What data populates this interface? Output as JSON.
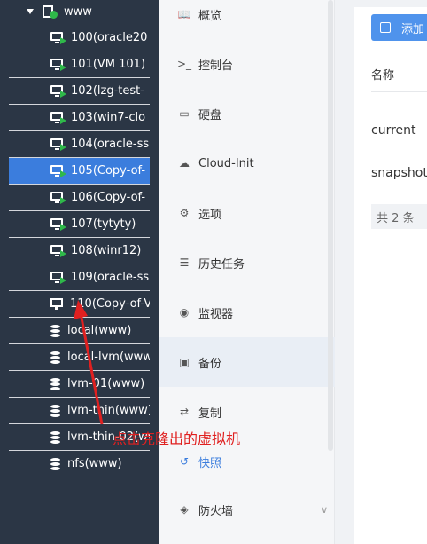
{
  "tree": {
    "host": {
      "label": "www",
      "icon": "server-check-icon"
    },
    "vms": [
      {
        "label": "100(oracle20",
        "icon": "vm-running-icon"
      },
      {
        "label": "101(VM 101)",
        "icon": "vm-running-icon"
      },
      {
        "label": "102(lzg-test-",
        "icon": "vm-running-icon"
      },
      {
        "label": "103(win7-clo",
        "icon": "vm-running-icon"
      },
      {
        "label": "104(oracle-ss",
        "icon": "vm-running-icon"
      },
      {
        "label": "105(Copy-of-",
        "icon": "vm-running-icon",
        "selected": true
      },
      {
        "label": "106(Copy-of-",
        "icon": "vm-running-icon"
      },
      {
        "label": "107(tytyty)",
        "icon": "vm-running-icon"
      },
      {
        "label": "108(winr12)",
        "icon": "vm-running-icon"
      },
      {
        "label": "109(oracle-ss",
        "icon": "vm-running-icon"
      },
      {
        "label": "110(Copy-of-V",
        "icon": "vm-stopped-icon"
      }
    ],
    "storages": [
      {
        "label": "local(www)"
      },
      {
        "label": "local-lvm(www"
      },
      {
        "label": "lvm-01(www)"
      },
      {
        "label": "lvm-thin(www)"
      },
      {
        "label": "lvm-thin-02(ww"
      },
      {
        "label": "nfs(www)"
      }
    ]
  },
  "menu": {
    "items": [
      {
        "label": "概览",
        "icon": "book-icon",
        "glyph": "📖"
      },
      {
        "label": "控制台",
        "icon": "terminal-icon",
        "glyph": ">_"
      },
      {
        "label": "硬盘",
        "icon": "monitor-icon",
        "glyph": "▭"
      },
      {
        "label": "Cloud-Init",
        "icon": "cloud-icon",
        "glyph": "☁"
      },
      {
        "label": "选项",
        "icon": "gear-icon",
        "glyph": "⚙"
      },
      {
        "label": "历史任务",
        "icon": "list-icon",
        "glyph": "☰"
      },
      {
        "label": "监视器",
        "icon": "eye-icon",
        "glyph": "◉"
      },
      {
        "label": "备份",
        "icon": "floppy-icon",
        "glyph": "▣"
      },
      {
        "label": "复制",
        "icon": "sync-icon",
        "glyph": "⇄"
      },
      {
        "label": "快照",
        "icon": "history-icon",
        "glyph": "↺"
      },
      {
        "label": "防火墙",
        "icon": "shield-icon",
        "glyph": "◈",
        "chevron": "∨"
      }
    ]
  },
  "snapshots": {
    "add_label": "添加",
    "column_name": "名称",
    "rows": [
      "current",
      "snapshot-"
    ],
    "total": "共 2 条"
  },
  "annotation": {
    "text": "点击克隆出的虚拟机",
    "color": "#e02020"
  },
  "colors": {
    "sidebar_bg": "#2b3645",
    "selected_bg": "#3b7ddd",
    "running_green": "#2fb84a",
    "primary_button": "#4f93ec"
  }
}
